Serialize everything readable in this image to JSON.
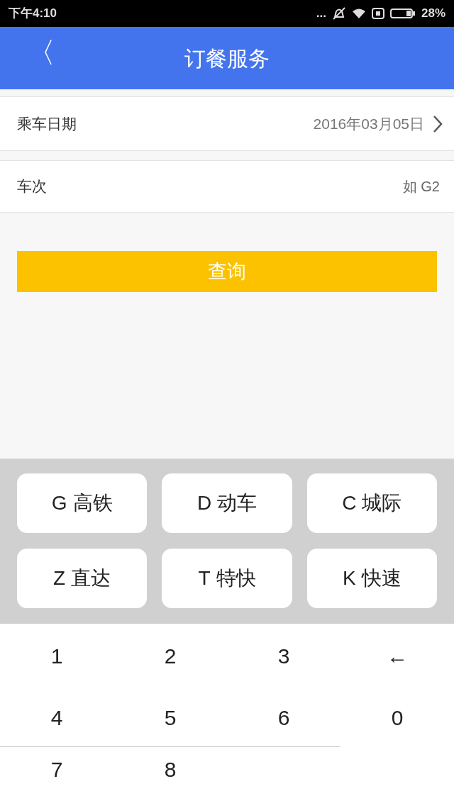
{
  "status_bar": {
    "time": "下午4:10",
    "dots": "...",
    "battery": "28%"
  },
  "header": {
    "back": "〈",
    "title": "订餐服务"
  },
  "form": {
    "date": {
      "label": "乘车日期",
      "value": "2016年03月05日"
    },
    "train": {
      "label": "车次",
      "placeholder": "如 G2"
    }
  },
  "query_button": "查询",
  "type_keys": [
    {
      "letter": "G",
      "label": "高铁"
    },
    {
      "letter": "D",
      "label": "动车"
    },
    {
      "letter": "C",
      "label": "城际"
    },
    {
      "letter": "Z",
      "label": "直达"
    },
    {
      "letter": "T",
      "label": "特快"
    },
    {
      "letter": "K",
      "label": "快速"
    }
  ],
  "num_keys": [
    "1",
    "2",
    "3",
    "←",
    "4",
    "5",
    "6",
    "0",
    "7",
    "8"
  ]
}
